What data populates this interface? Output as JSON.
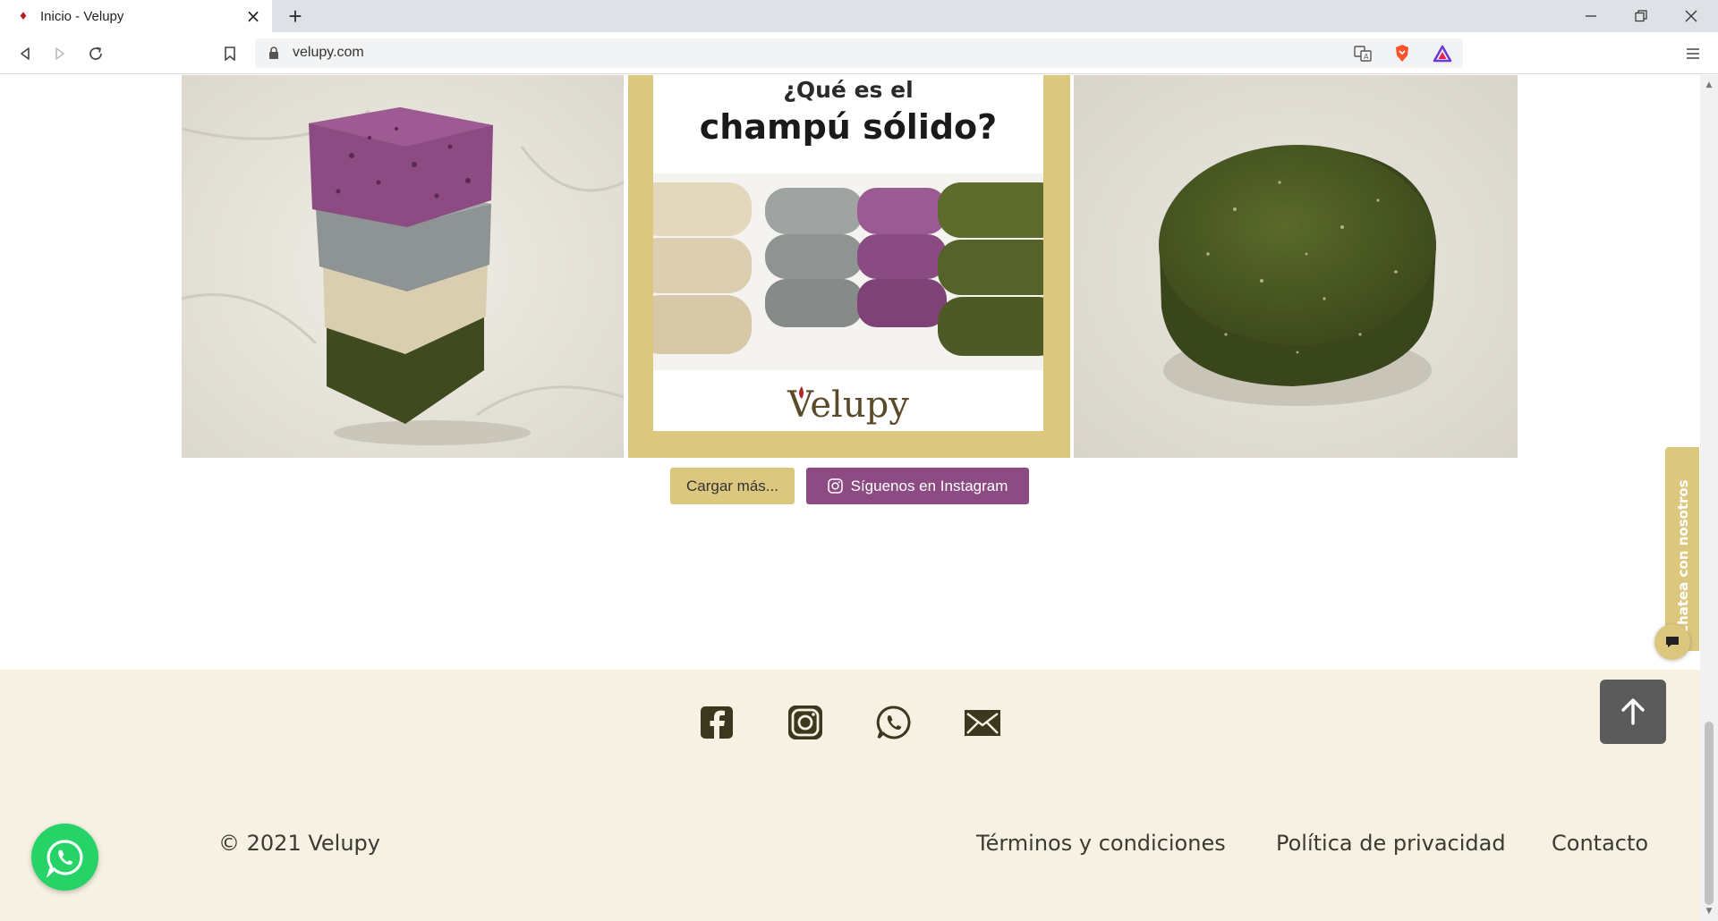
{
  "browser": {
    "tab_title": "Inicio - Velupy",
    "url": "velupy.com"
  },
  "gallery": {
    "promo_question_line1": "¿Qué es el",
    "promo_question_line2": "champú sólido?",
    "promo_brand": "Velupy",
    "load_more_label": "Cargar más...",
    "instagram_label": "Síguenos en Instagram"
  },
  "footer": {
    "copyright": "© 2021 Velupy",
    "links": [
      "Términos y condiciones",
      "Política de privacidad",
      "Contacto"
    ],
    "social_icons": [
      "facebook-icon",
      "instagram-icon",
      "whatsapp-icon",
      "email-icon"
    ]
  },
  "widgets": {
    "chat_label": "Chatea con nosotros"
  },
  "colors": {
    "accent_gold": "#dcc77f",
    "instagram_purple": "#8c4b82",
    "footer_bg": "#f6f1e2",
    "whatsapp_green": "#25d366",
    "icon_dark": "#3b3820"
  }
}
